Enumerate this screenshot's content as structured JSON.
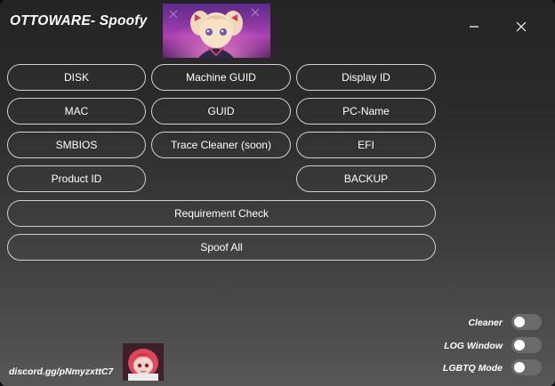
{
  "window": {
    "title": "OTTOWARE- Spoofy",
    "minimize_icon": "minimize-icon",
    "close_icon": "close-icon"
  },
  "buttons": {
    "disk": "DISK",
    "machine_guid": "Machine GUID",
    "display_id": "Display ID",
    "mac": "MAC",
    "guid": "GUID",
    "pc_name": "PC-Name",
    "smbios": "SMBIOS",
    "trace_cleaner": "Trace Cleaner (soon)",
    "efi": "EFI",
    "product_id": "Product ID",
    "backup": "BACKUP",
    "requirement_check": "Requirement Check",
    "spoof_all": "Spoof All"
  },
  "toggles": {
    "cleaner": {
      "label": "Cleaner",
      "on": false
    },
    "log_window": {
      "label": "LOG Window",
      "on": false
    },
    "lgbtq_mode": {
      "label": "LGBTQ Mode",
      "on": false
    }
  },
  "footer": {
    "discord_link": "discord.gg/pNmyzxttC7"
  },
  "colors": {
    "text": "#ffffff",
    "button_border": "#d0d0d0",
    "toggle_off": "#6b6b6b"
  }
}
